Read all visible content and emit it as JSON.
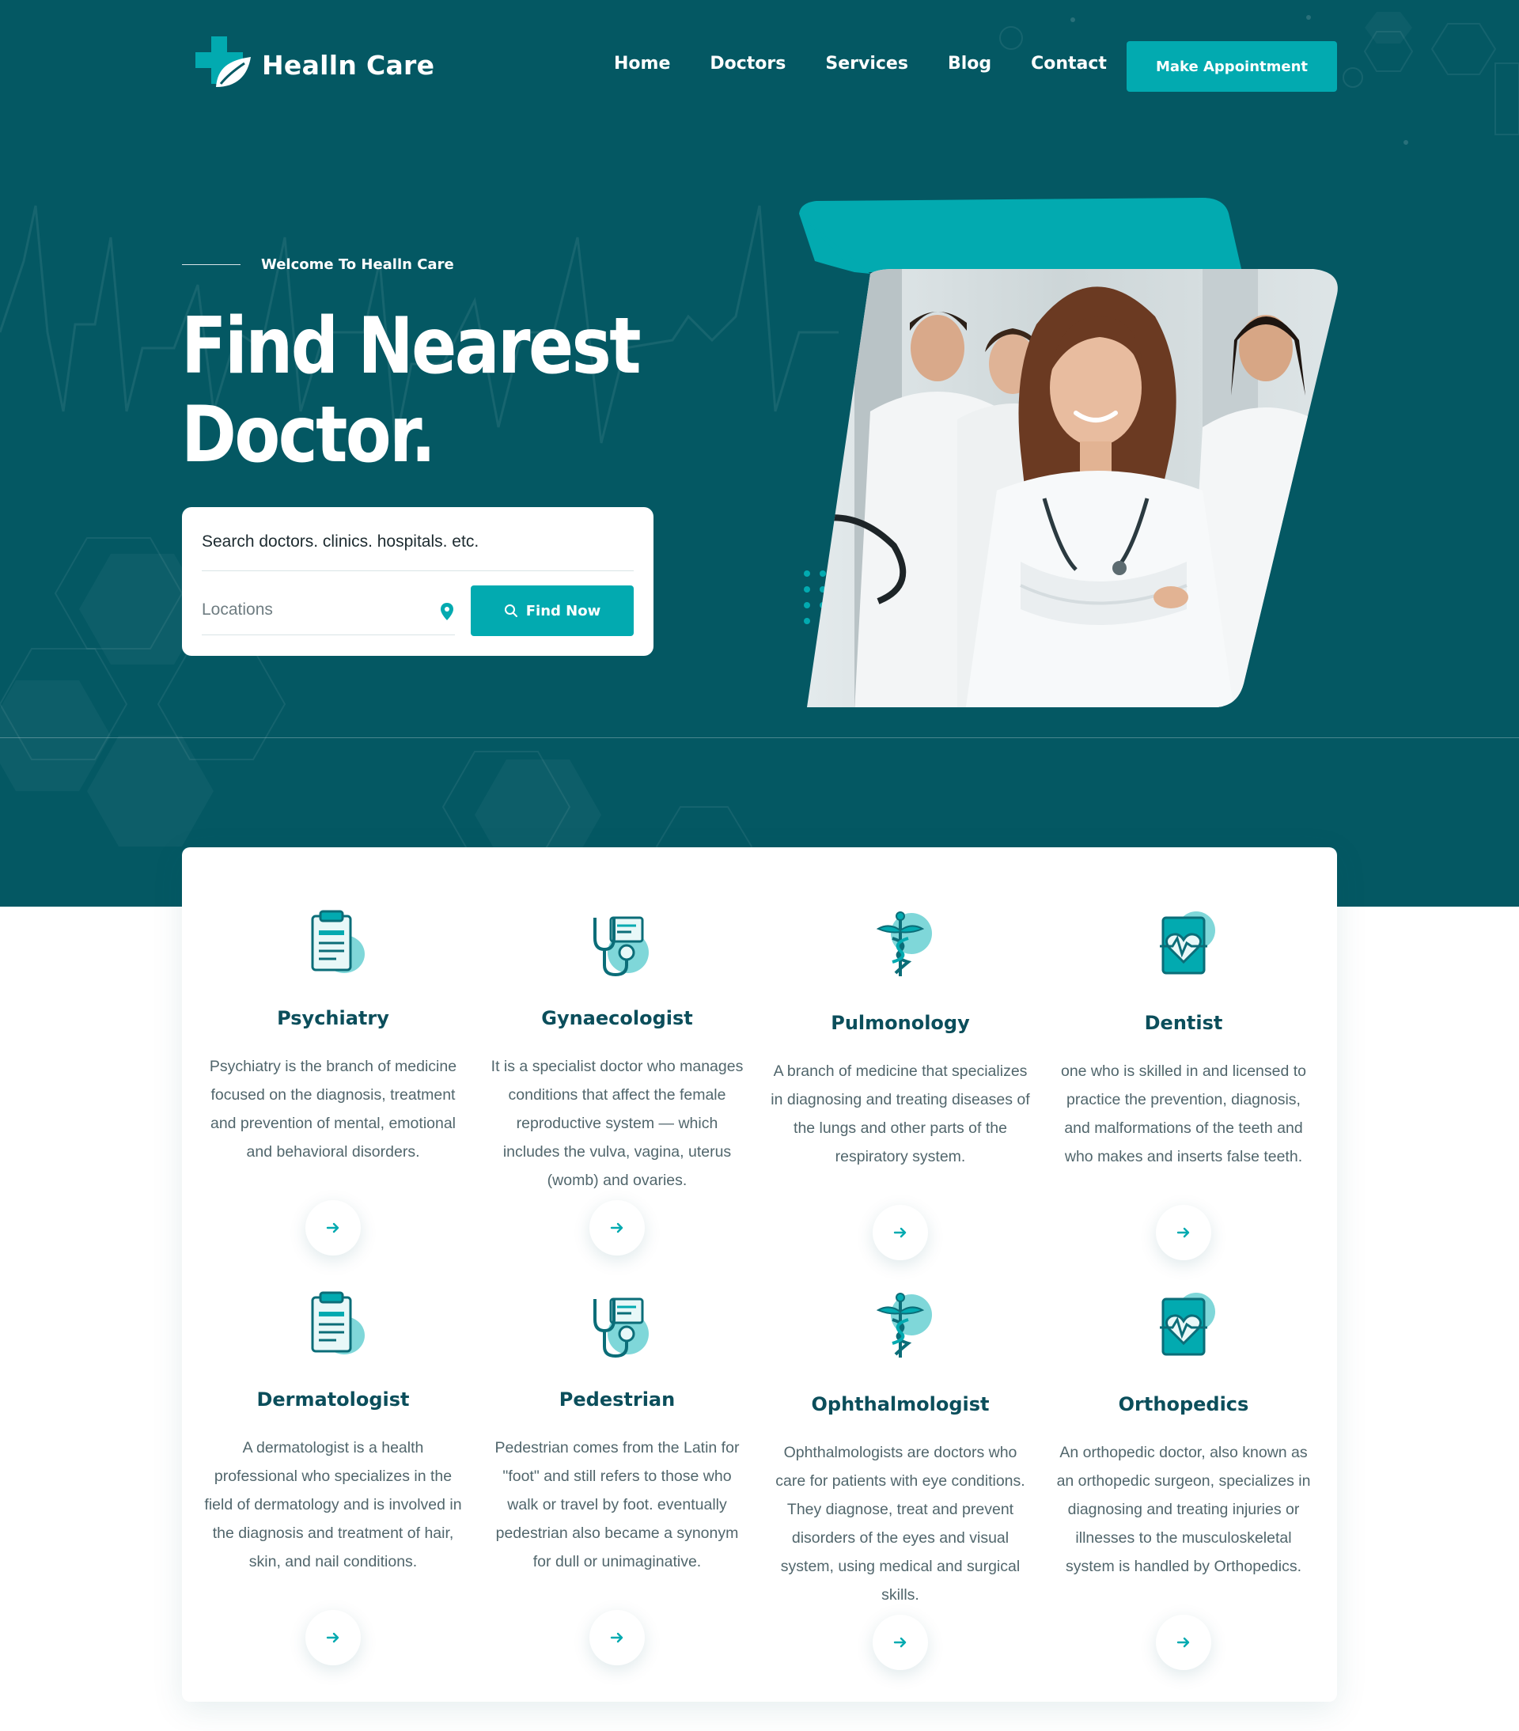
{
  "header": {
    "logo_text": "Healln Care",
    "nav": [
      "Home",
      "Doctors",
      "Services",
      "Blog",
      "Contact"
    ],
    "cta_label": "Make Appointment"
  },
  "hero": {
    "welcome": "Welcome To Healln Care",
    "title_line1": "Find Nearest",
    "title_line2": "Doctor.",
    "search_text": "Search doctors. clinics. hospitals. etc.",
    "location_placeholder": "Locations",
    "find_button": "Find Now",
    "photo_alt": "Smiling female doctor in a white coat with colleagues"
  },
  "services": [
    {
      "title": "Psychiatry",
      "icon": "clipboard-icon",
      "desc": "Psychiatry is the branch of medicine focused on the diagnosis, treatment and prevention of mental, emotional and behavioral disorders."
    },
    {
      "title": "Gynaecologist",
      "icon": "stethoscope-icon",
      "desc": "It is a specialist doctor who manages conditions that affect the female reproductive system — which includes the vulva, vagina, uterus (womb) and ovaries."
    },
    {
      "title": "Pulmonology",
      "icon": "caduceus-icon",
      "desc": "A branch of medicine that specializes in diagnosing and treating diseases of the lungs and other parts of the respiratory system."
    },
    {
      "title": "Dentist",
      "icon": "heart-monitor-icon",
      "desc": "one who is skilled in and licensed to practice the prevention, diagnosis, and malformations of the teeth and who makes and inserts false teeth."
    },
    {
      "title": "Dermatologist",
      "icon": "clipboard-icon",
      "desc": "A dermatologist is a health professional who specializes in the field of dermatology and is involved in the diagnosis and treatment of hair, skin, and nail conditions."
    },
    {
      "title": "Pedestrian",
      "icon": "stethoscope-icon",
      "desc": "Pedestrian comes from the Latin for \"foot\" and still refers to those who walk or travel by foot. eventually pedestrian also became a synonym for dull or unimaginative."
    },
    {
      "title": "Ophthalmologist",
      "icon": "caduceus-icon",
      "desc": "Ophthalmologists are doctors who care for patients with eye conditions. They diagnose, treat and prevent disorders of the eyes and visual system, using medical and surgical skills."
    },
    {
      "title": "Orthopedics",
      "icon": "heart-monitor-icon",
      "desc": "An orthopedic doctor, also known as an orthopedic surgeon, specializes in diagnosing and treating injuries or illnesses to the musculoskeletal system is handled by Orthopedics."
    }
  ],
  "colors": {
    "primary": "#045863",
    "accent": "#02aab0",
    "heading": "#0b4e5b"
  }
}
